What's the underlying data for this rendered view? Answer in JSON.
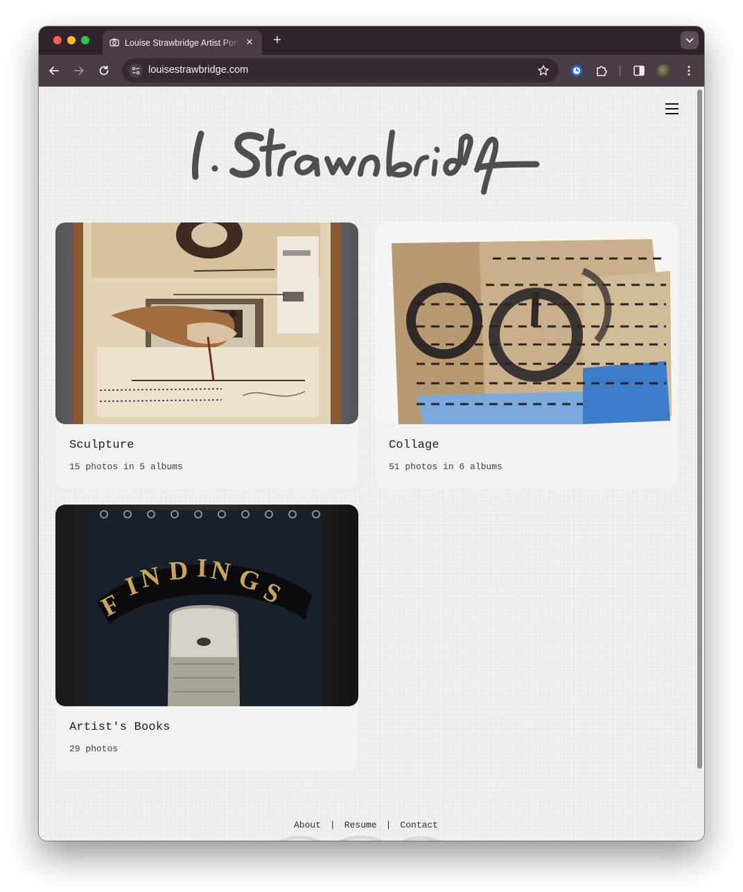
{
  "browser": {
    "tab_title": "Louise Strawbridge Artist Portfolio",
    "url": "louisestrawbridge.com",
    "new_tab_label": "+",
    "close_tab_label": "✕"
  },
  "site": {
    "logo_text": "l. Strawbridge",
    "menu_icon": "hamburger-menu-icon"
  },
  "gallery": [
    {
      "title": "Sculpture",
      "meta": "15 photos in 5 albums",
      "image": "assemblage-box-with-bird"
    },
    {
      "title": "Collage",
      "meta": "51 photos in 6 albums",
      "image": "stitched-paper-collage-with-circles"
    },
    {
      "title": "Artist's Books",
      "meta": "29 photos",
      "image": "findings-book-cover"
    }
  ],
  "footer": {
    "links": [
      "About",
      "Resume",
      "Contact"
    ],
    "separator": "|"
  },
  "colors": {
    "tab_bar": "#2f232c",
    "toolbar": "#4a3c47",
    "page_background": "#efefed",
    "card_background": "#f2f2f2"
  }
}
